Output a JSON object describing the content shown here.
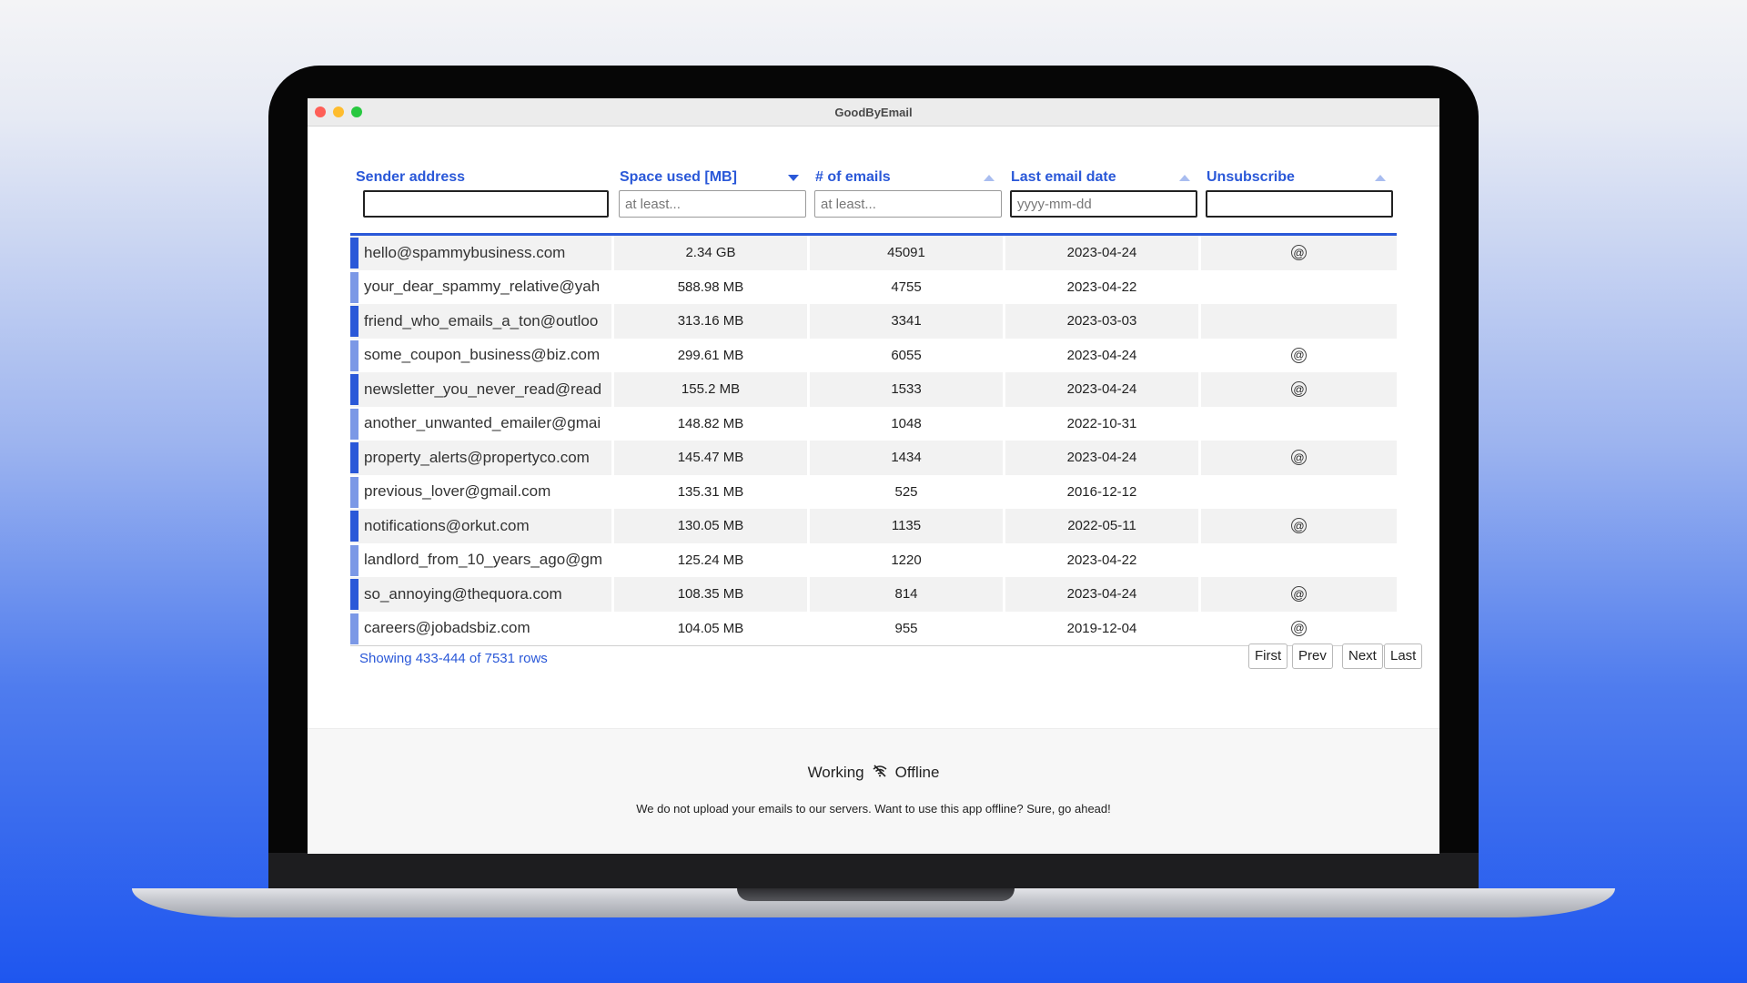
{
  "window": {
    "title": "GoodByEmail"
  },
  "table": {
    "headers": [
      {
        "label": "Sender address",
        "placeholder": ""
      },
      {
        "label": "Space used [MB]",
        "placeholder": "at least..."
      },
      {
        "label": "# of emails",
        "placeholder": "at least..."
      },
      {
        "label": "Last email date",
        "placeholder": "yyyy-mm-dd"
      },
      {
        "label": "Unsubscribe",
        "placeholder": ""
      }
    ],
    "rows": [
      {
        "sender": "hello@spammybusiness.com",
        "space": "2.34 GB",
        "count": "45091",
        "date": "2023-04-24",
        "unsub": true
      },
      {
        "sender": "your_dear_spammy_relative@yah",
        "space": "588.98 MB",
        "count": "4755",
        "date": "2023-04-22",
        "unsub": false
      },
      {
        "sender": "friend_who_emails_a_ton@outloo",
        "space": "313.16 MB",
        "count": "3341",
        "date": "2023-03-03",
        "unsub": false
      },
      {
        "sender": "some_coupon_business@biz.com",
        "space": "299.61 MB",
        "count": "6055",
        "date": "2023-04-24",
        "unsub": true
      },
      {
        "sender": "newsletter_you_never_read@read",
        "space": "155.2 MB",
        "count": "1533",
        "date": "2023-04-24",
        "unsub": true
      },
      {
        "sender": "another_unwanted_emailer@gmai",
        "space": "148.82 MB",
        "count": "1048",
        "date": "2022-10-31",
        "unsub": false
      },
      {
        "sender": "property_alerts@propertyco.com",
        "space": "145.47 MB",
        "count": "1434",
        "date": "2023-04-24",
        "unsub": true
      },
      {
        "sender": "previous_lover@gmail.com",
        "space": "135.31 MB",
        "count": "525",
        "date": "2016-12-12",
        "unsub": false
      },
      {
        "sender": "notifications@orkut.com",
        "space": "130.05 MB",
        "count": "1135",
        "date": "2022-05-11",
        "unsub": true
      },
      {
        "sender": "landlord_from_10_years_ago@gm",
        "space": "125.24 MB",
        "count": "1220",
        "date": "2023-04-22",
        "unsub": false
      },
      {
        "sender": "so_annoying@thequora.com",
        "space": "108.35 MB",
        "count": "814",
        "date": "2023-04-24",
        "unsub": true
      },
      {
        "sender": "careers@jobadsbiz.com",
        "space": "104.05 MB",
        "count": "955",
        "date": "2019-12-04",
        "unsub": true
      }
    ],
    "unsubscribe_icon": "at-sign-icon",
    "bar_colors": {
      "dark": "#2a58d8",
      "light": "#7b98e6"
    }
  },
  "pagination": {
    "status": "Showing 433-444 of 7531 rows",
    "first": "First",
    "prev": "Prev",
    "next": "Next",
    "last": "Last"
  },
  "footer": {
    "status_left": "Working",
    "status_icon": "wifi-off-icon",
    "status_right": "Offline",
    "note": "We do not upload your emails to our servers. Want to use this app offline? Sure, go ahead!"
  },
  "colors": {
    "accent": "#2a58d8"
  }
}
